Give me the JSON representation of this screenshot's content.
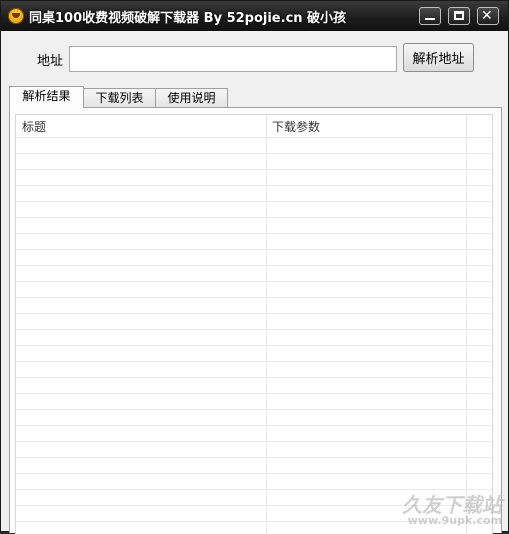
{
  "window": {
    "title": "同桌100收费视频破解下载器 By 52pojie.cn 破小孩",
    "controls": {
      "minimize_icon": "minimize-icon",
      "maximize_icon": "maximize-icon",
      "close_icon": "close-icon",
      "close_glyph": "✕"
    }
  },
  "address": {
    "label": "地址",
    "value": "",
    "placeholder": ""
  },
  "parse_button": {
    "label": "解析地址"
  },
  "tabs": [
    {
      "label": "解析结果",
      "active": true
    },
    {
      "label": "下载列表",
      "active": false
    },
    {
      "label": "使用说明",
      "active": false
    }
  ],
  "results_table": {
    "columns": [
      "标题",
      "下载参数"
    ],
    "rows": []
  },
  "watermark": {
    "line1": "久友下载站",
    "line2": "www.9upk.com"
  }
}
